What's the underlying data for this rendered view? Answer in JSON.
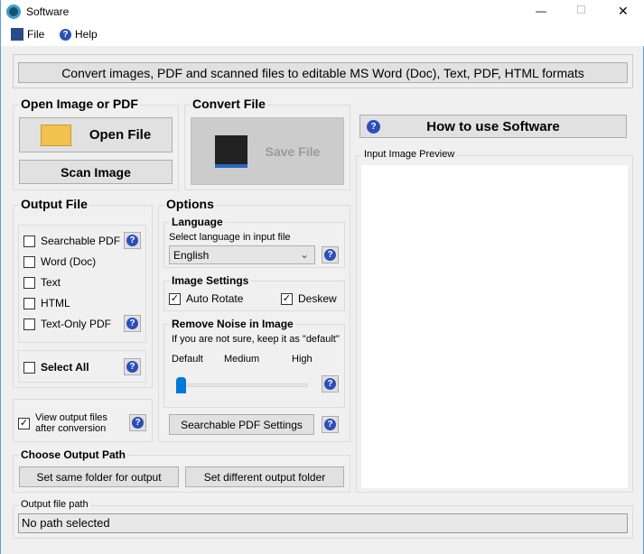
{
  "window": {
    "title": "Software",
    "controls": [
      "—",
      "☐",
      "✕"
    ]
  },
  "menu": {
    "file": "File",
    "help": "Help"
  },
  "banner": "Convert images, PDF and scanned files to editable MS Word (Doc), Text, PDF, HTML formats",
  "open_group": {
    "title": "Open Image or PDF",
    "open_file": "Open File",
    "scan_image": "Scan Image"
  },
  "convert_group": {
    "title": "Convert File",
    "save_file": "Save File"
  },
  "how_to": "How to use Software",
  "preview": {
    "title": "Input Image Preview"
  },
  "output_file": {
    "title": "Output File",
    "items": [
      {
        "label": "Searchable PDF",
        "checked": false
      },
      {
        "label": "Word (Doc)",
        "checked": false
      },
      {
        "label": "Text",
        "checked": false
      },
      {
        "label": "HTML",
        "checked": false
      },
      {
        "label": "Text-Only PDF",
        "checked": false
      }
    ],
    "select_all": "Select All"
  },
  "view_output": {
    "line1": "View output files",
    "line2": "after conversion",
    "checked": true
  },
  "options": {
    "title": "Options",
    "language": {
      "title": "Language",
      "hint": "Select language in input file",
      "value": "English"
    },
    "image_settings": {
      "title": "Image Settings",
      "auto_rotate": "Auto Rotate",
      "deskew": "Deskew"
    },
    "noise": {
      "title": "Remove Noise in Image",
      "hint": "If you are not sure, keep it as \"default\"",
      "default": "Default",
      "medium": "Medium",
      "high": "High",
      "level": 0
    },
    "pdf_settings": "Searchable PDF Settings"
  },
  "output_path": {
    "title": "Choose Output Path",
    "same": "Set same folder for output",
    "different": "Set different output folder"
  },
  "path": {
    "title": "Output file path",
    "value": "No path selected"
  },
  "help_glyph": "?"
}
